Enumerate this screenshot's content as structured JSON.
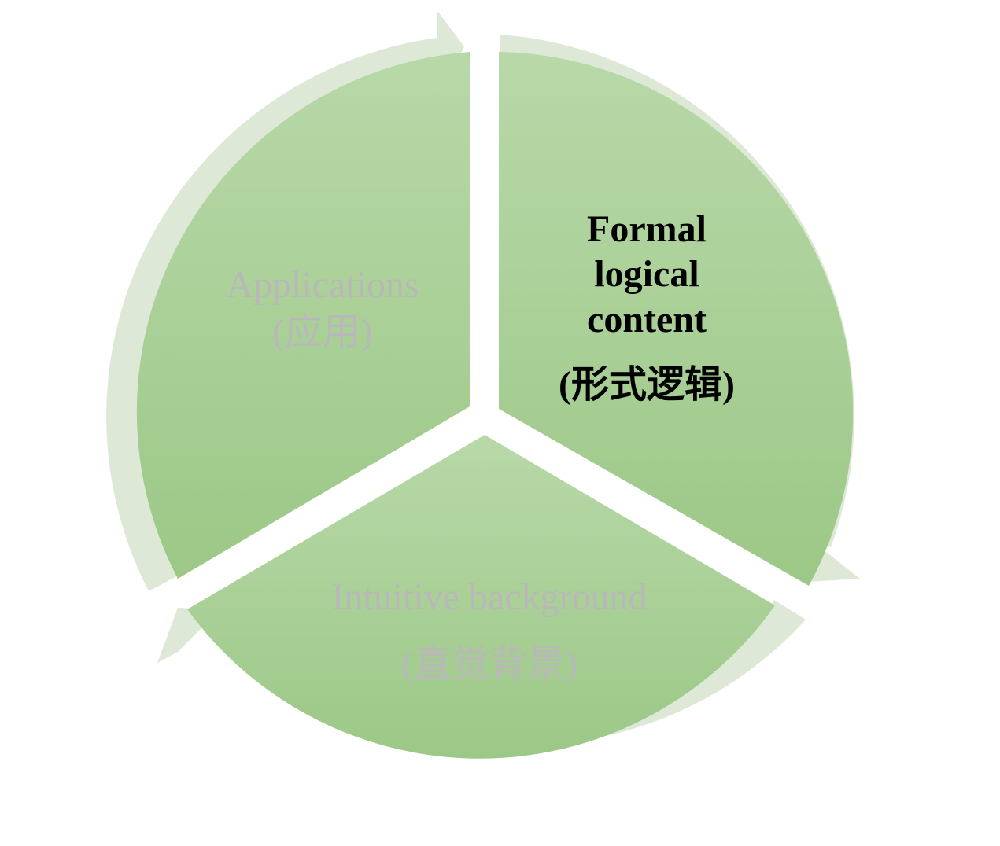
{
  "diagram": {
    "type": "cycle",
    "segments": [
      {
        "id": "formal",
        "lines": [
          "Formal",
          "logical",
          "content"
        ],
        "sub": "(形式逻辑)",
        "emphasis": true
      },
      {
        "id": "intuitive",
        "lines": [
          "Intuitive background"
        ],
        "sub": "(直觉背景)",
        "emphasis": false
      },
      {
        "id": "applications",
        "lines": [
          "Applications"
        ],
        "sub": "(应用)",
        "emphasis": false
      }
    ],
    "colors": {
      "segment_top": "#b8d8a8",
      "segment_bottom": "#9cc887",
      "arrow": "#dde9d6",
      "muted_text": "#b8b8b8",
      "strong_text": "#000000"
    }
  }
}
